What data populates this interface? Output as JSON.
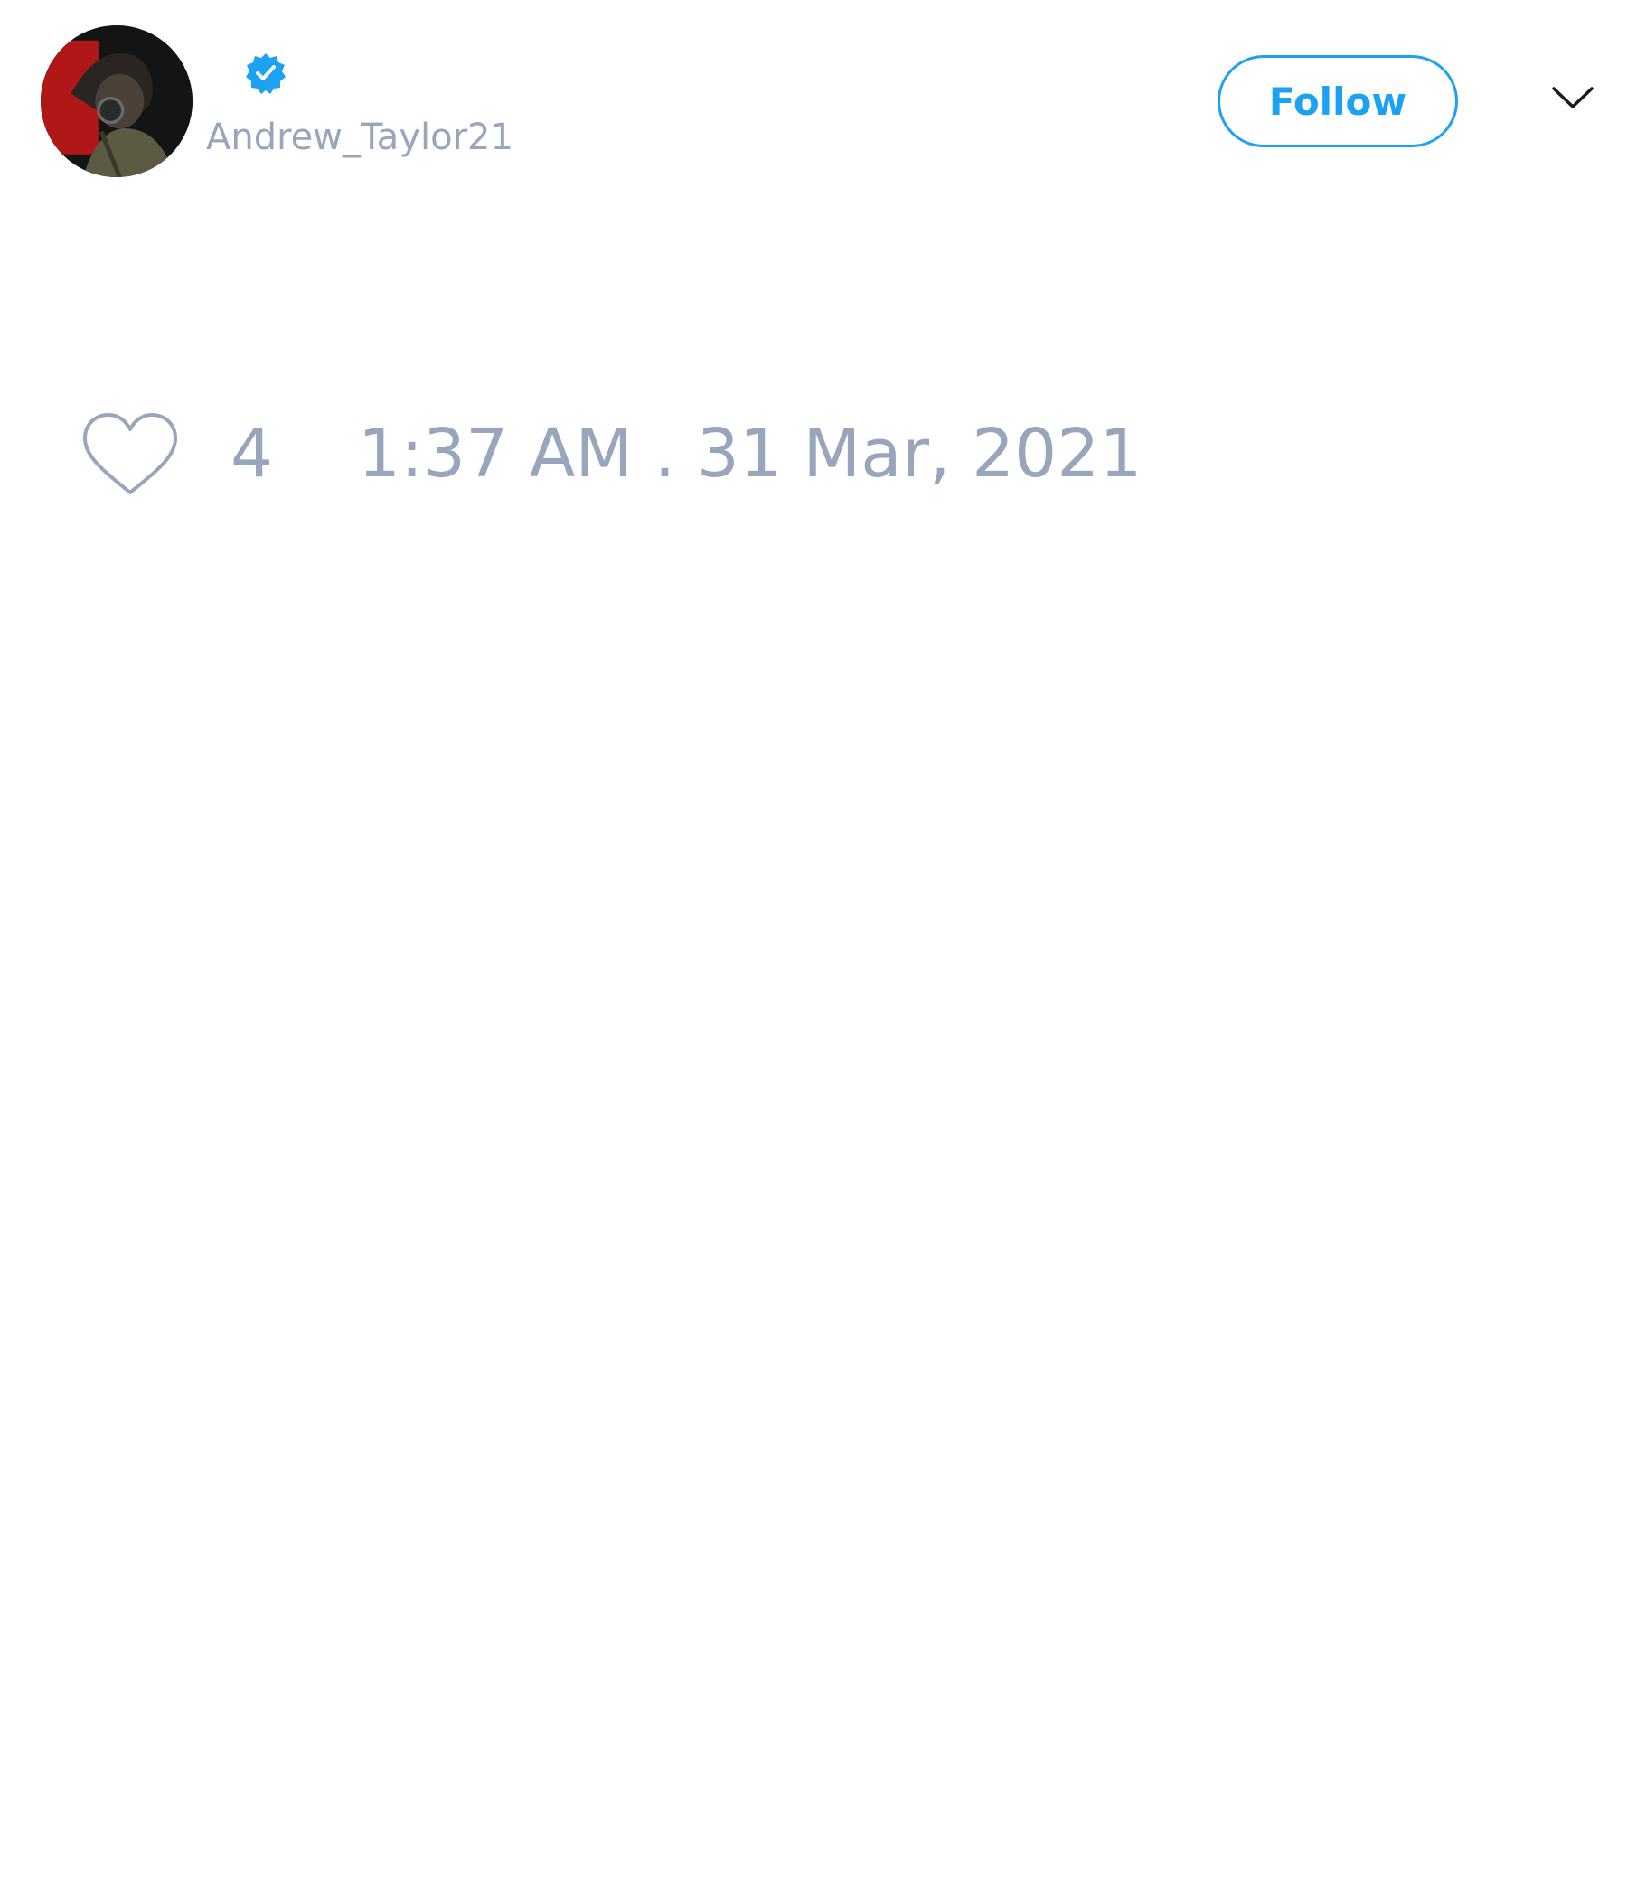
{
  "user": {
    "handle": "Andrew_Taylor21",
    "verified": true,
    "avatar": "profile-photo-gas-mask"
  },
  "header": {
    "follow_label": "Follow",
    "menu_icon": "chevron-down-icon"
  },
  "stats": {
    "like_icon": "heart-icon",
    "like_count": "4",
    "timestamp": "1:37 AM . 31 Mar, 2021"
  },
  "colors": {
    "accent": "#1da1f2",
    "muted_text": "#98a6bb",
    "verified_badge": "#1da1f2"
  }
}
